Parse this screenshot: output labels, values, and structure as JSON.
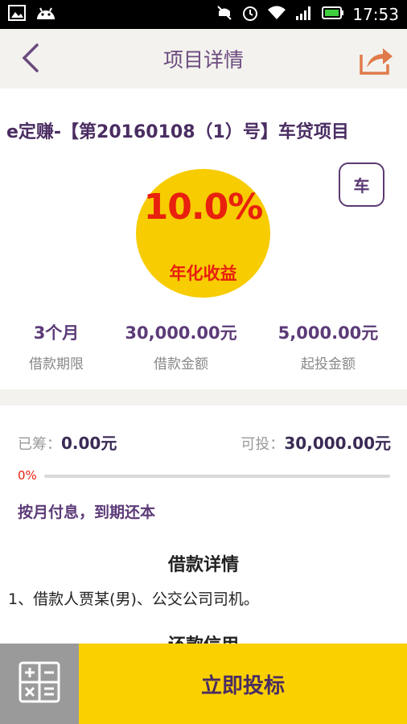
{
  "status_bar": {
    "time": "17:53",
    "icons": [
      "image-icon",
      "android-icon",
      "mute-icon",
      "alarm-icon",
      "wifi-icon",
      "signal-icon",
      "battery-icon"
    ]
  },
  "nav": {
    "title": "项目详情",
    "back_icon": "chevron-left-icon",
    "share_icon": "share-icon"
  },
  "project": {
    "title": "e定赚-【第20160108（1）号】车贷项目",
    "rate": "10.0%",
    "rate_label": "年化收益",
    "tag": "车"
  },
  "stats": [
    {
      "value": "3个月",
      "label": "借款期限"
    },
    {
      "value": "30,000.00元",
      "label": "借款金额"
    },
    {
      "value": "5,000.00元",
      "label": "起投金额"
    }
  ],
  "funding": {
    "raised_label": "已筹：",
    "raised_value": "0.00元",
    "available_label": "可投：",
    "available_value": "30,000.00元",
    "progress_text": "0%",
    "progress": 0
  },
  "repayment_method": "按月付息，到期还本",
  "loan_details": {
    "heading": "借款详情",
    "text": "1、借款人贾某(男)、公交公司司机。"
  },
  "repayment_section": {
    "heading": "还款信用"
  },
  "bottom": {
    "invest_label": "立即投标",
    "calc_icon": "calculator-icon"
  },
  "colors": {
    "accent": "#f7cc00",
    "brand_purple": "#5c3b78",
    "rate_red": "#e8200e"
  }
}
